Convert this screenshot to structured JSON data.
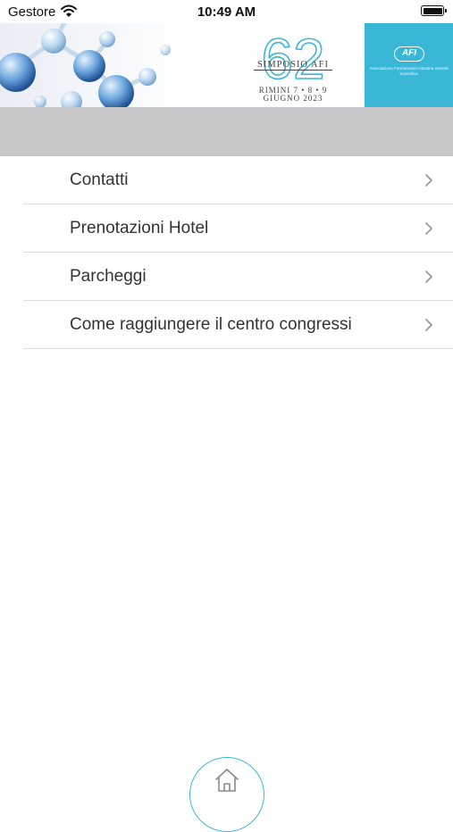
{
  "status_bar": {
    "carrier": "Gestore",
    "time": "10:49 AM",
    "wifi_icon": "wifi-icon",
    "battery_icon": "battery-icon"
  },
  "banner": {
    "event_number": "62",
    "event_name": "SIMPOSIO AFI",
    "location_dates": "RIMINI 7 • 8 • 9",
    "month_year": "GIUGNO 2023",
    "org_logo_text": "AFI",
    "org_name": "Associazione Farmaceutici Industria Società Scientifica",
    "accent_color": "#3ab7d6"
  },
  "menu": {
    "items": [
      {
        "label": "Contatti"
      },
      {
        "label": "Prenotazioni Hotel"
      },
      {
        "label": "Parcheggi"
      },
      {
        "label": "Come raggiungere il centro congressi"
      }
    ]
  },
  "footer": {
    "home_icon": "home-icon"
  }
}
